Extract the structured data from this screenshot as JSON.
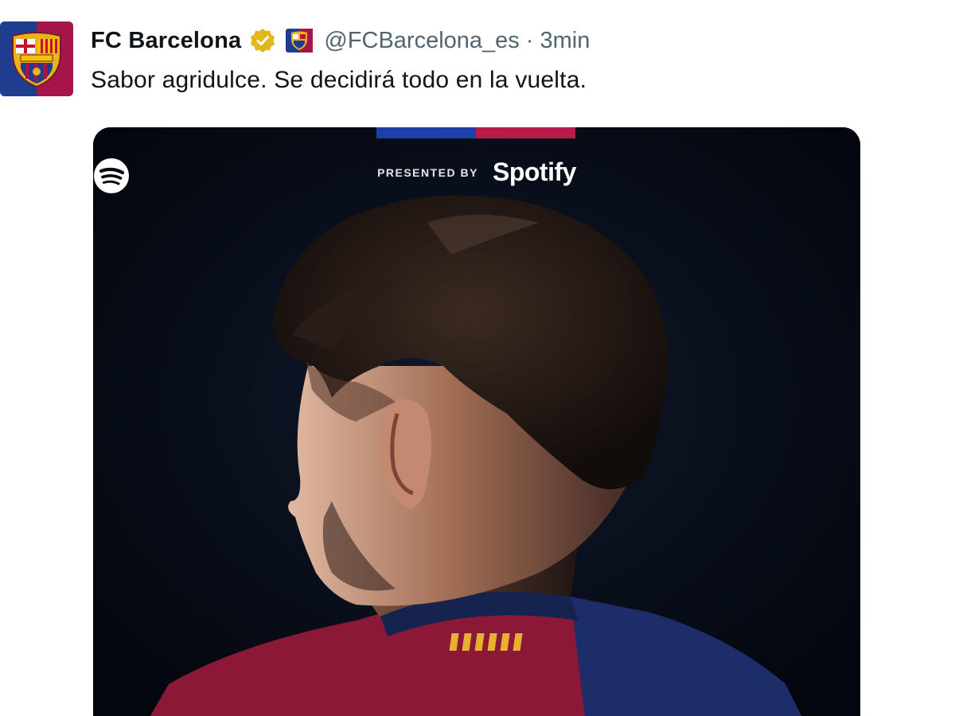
{
  "tweet": {
    "author": {
      "display_name": "FC Barcelona",
      "handle": "@FCBarcelona_es",
      "verified_badge": "gold-verified-icon",
      "affiliate_badge": "fcb-crest-badge-icon"
    },
    "separator": "·",
    "timestamp": "3min",
    "text": "Sabor agridulce. Se decidirá todo en la vuelta."
  },
  "media": {
    "sponsor_prefix": "PRESENTED BY",
    "sponsor_name": "Spotify",
    "sponsor_icon": "spotify-icon",
    "colors": {
      "background": "#05080f",
      "blaugrana_blue": "#1f3fa8",
      "blaugrana_red": "#b71c4a"
    }
  }
}
